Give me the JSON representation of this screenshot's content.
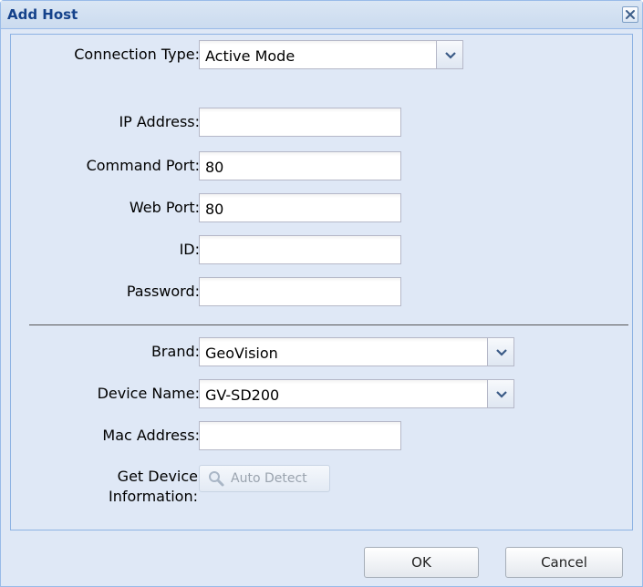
{
  "dialog": {
    "title": "Add Host",
    "close_icon": "close-icon"
  },
  "form": {
    "connection_type": {
      "label": "Connection Type:",
      "value": "Active Mode"
    },
    "ip_address": {
      "label": "IP Address:",
      "value": ""
    },
    "command_port": {
      "label": "Command Port:",
      "value": "80"
    },
    "web_port": {
      "label": "Web Port:",
      "value": "80"
    },
    "id": {
      "label": "ID:",
      "value": ""
    },
    "password": {
      "label": "Password:",
      "value": ""
    },
    "brand": {
      "label": "Brand:",
      "value": "GeoVision"
    },
    "device_name": {
      "label": "Device Name:",
      "value": "GV-SD200"
    },
    "mac_address": {
      "label": "Mac Address:",
      "value": ""
    },
    "get_device_info": {
      "label_line1": "Get Device",
      "label_line2": "Information:",
      "button_label": "Auto Detect",
      "button_icon": "magnifier-icon"
    }
  },
  "footer": {
    "ok_label": "OK",
    "cancel_label": "Cancel"
  },
  "colors": {
    "dialog_bg": "#dfe8f6",
    "border": "#99bbe8",
    "title_text": "#15428b"
  }
}
